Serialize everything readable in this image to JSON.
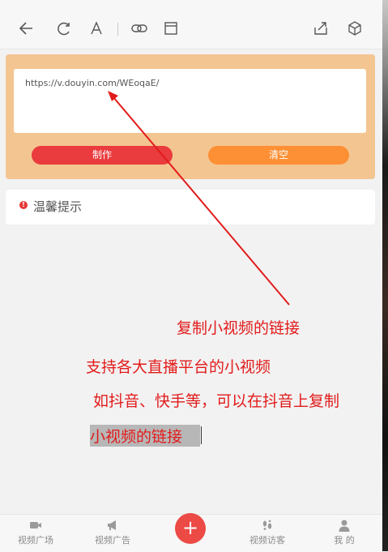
{
  "toolbar": {
    "icons": [
      "back-icon",
      "refresh-icon",
      "text-icon",
      "link-icon",
      "window-icon",
      "share-icon",
      "cube-icon"
    ]
  },
  "form": {
    "url_value": "https://v.douyin.com/WEoqaE/",
    "make_button": "制作",
    "clear_button": "清空"
  },
  "tip": {
    "icon": "!",
    "label": "温馨提示"
  },
  "annotations": {
    "line1": "复制小视频的链接",
    "line2": "支持各大直播平台的小视频",
    "line3": "如抖音、快手等，可以在抖音上复制",
    "line4": "小视频的链接",
    "color": "#e21b1b"
  },
  "bottom_nav": {
    "items": [
      {
        "label": "视频广场",
        "icon": "video-icon"
      },
      {
        "label": "视频广告",
        "icon": "megaphone-icon"
      },
      {
        "label": "+",
        "icon": "plus-icon"
      },
      {
        "label": "视频访客",
        "icon": "footprint-icon"
      },
      {
        "label": "我 的",
        "icon": "user-icon"
      }
    ]
  },
  "colors": {
    "panel_orange": "#f3c591",
    "make_red": "#ea3b3e",
    "clear_orange": "#fd8f34",
    "fab_red": "#ec4a45"
  }
}
